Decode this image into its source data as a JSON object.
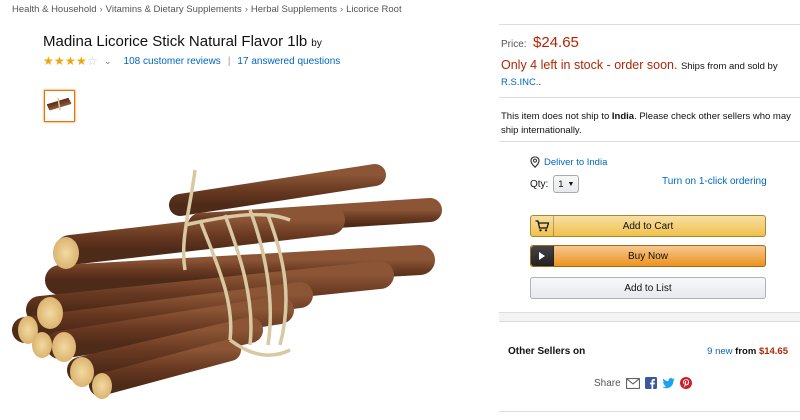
{
  "breadcrumb": [
    "Health & Household",
    "Vitamins & Dietary Supplements",
    "Herbal Supplements",
    "Licorice Root"
  ],
  "breadcrumb_separator": "›",
  "product": {
    "title": "Madina Licorice Stick Natural Flavor 1lb",
    "by_label": "by",
    "rating_stars": 4,
    "max_stars": 5,
    "reviews_label": "108 customer reviews",
    "questions_label": "17 answered questions"
  },
  "buybox": {
    "price_label": "Price:",
    "price_value": "$24.65",
    "stock_text": "Only 4 left in stock - order soon.",
    "ships_text": "Ships from and sold by",
    "seller_name": "R.S.INC.",
    "seller_suffix": ".",
    "ship_note_prefix": "This item does not ship to ",
    "ship_note_country": "India",
    "ship_note_suffix": ". Please check other sellers who may ship internationally.",
    "deliver_label": "Deliver to India",
    "qty_label": "Qty:",
    "qty_value": "1",
    "one_click_label": "Turn on 1-click ordering",
    "add_to_cart_label": "Add to Cart",
    "buy_now_label": "Buy Now",
    "add_to_list_label": "Add to List",
    "other_sellers_label": "Other Sellers on",
    "other_new_label": "9 new",
    "other_from_label": "from",
    "other_from_price": "$14.65",
    "share_label": "Share"
  },
  "icons": {
    "star": "star-icon",
    "location": "location-pin-icon",
    "cart": "cart-icon",
    "play": "play-icon",
    "email": "email-icon",
    "facebook": "facebook-icon",
    "twitter": "twitter-icon",
    "pinterest": "pinterest-icon"
  },
  "colors": {
    "price": "#b12704",
    "link": "#0066c0",
    "star": "#f0a30a",
    "cart_button": "#f0c14b",
    "buy_button": "#ed9220",
    "thumb_border": "#e77600"
  }
}
